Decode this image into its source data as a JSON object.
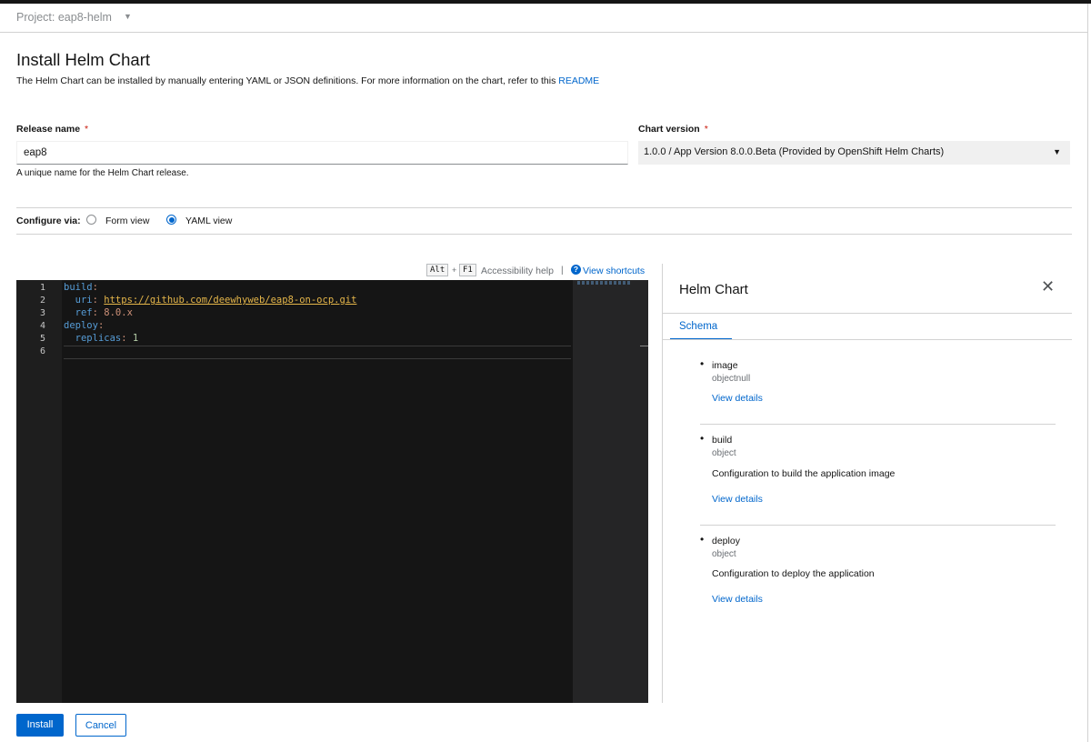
{
  "project": {
    "label": "Project: eap8-helm"
  },
  "page": {
    "title": "Install Helm Chart",
    "description": "The Helm Chart can be installed by manually entering YAML or JSON definitions.  For more information on the chart, refer to this ",
    "readme_link": "README"
  },
  "form": {
    "release_name_label": "Release name",
    "release_name_value": "eap8",
    "release_name_helper": "A unique name for the Helm Chart release.",
    "required_marker": "*",
    "chart_version_label": "Chart version",
    "chart_version_value": "1.0.0 / App Version 8.0.0.Beta (Provided by OpenShift Helm Charts)",
    "configure_label": "Configure via:",
    "configure_options": [
      "Form view",
      "YAML view"
    ],
    "configure_selected": "YAML view"
  },
  "editor": {
    "shortcut_keys": [
      "Alt",
      "F1"
    ],
    "shortcut_plus": "+",
    "accessibility_help": "Accessibility help",
    "separator": "|",
    "view_shortcuts": "View shortcuts",
    "line_numbers": [
      "1",
      "2",
      "3",
      "4",
      "5",
      "6"
    ],
    "code": {
      "l1_key": "build",
      "l2_key": "uri",
      "l2_value": "https://github.com/deewhyweb/eap8-on-ocp.git",
      "l3_key": "ref",
      "l3_value": "8.0.x",
      "l4_key": "deploy",
      "l5_key": "replicas",
      "l5_value": "1"
    }
  },
  "side_panel": {
    "title": "Helm Chart",
    "tab": "Schema",
    "items": [
      {
        "name": "image",
        "type": "objectnull",
        "description": "",
        "link": "View details"
      },
      {
        "name": "build",
        "type": "object",
        "description": "Configuration to build the application image",
        "link": "View details"
      },
      {
        "name": "deploy",
        "type": "object",
        "description": "Configuration to deploy the application",
        "link": "View details"
      }
    ]
  },
  "actions": {
    "install": "Install",
    "cancel": "Cancel"
  },
  "colors": {
    "primary": "#0066cc",
    "required": "#c9190b",
    "editor_bg": "#1e1e1e"
  }
}
